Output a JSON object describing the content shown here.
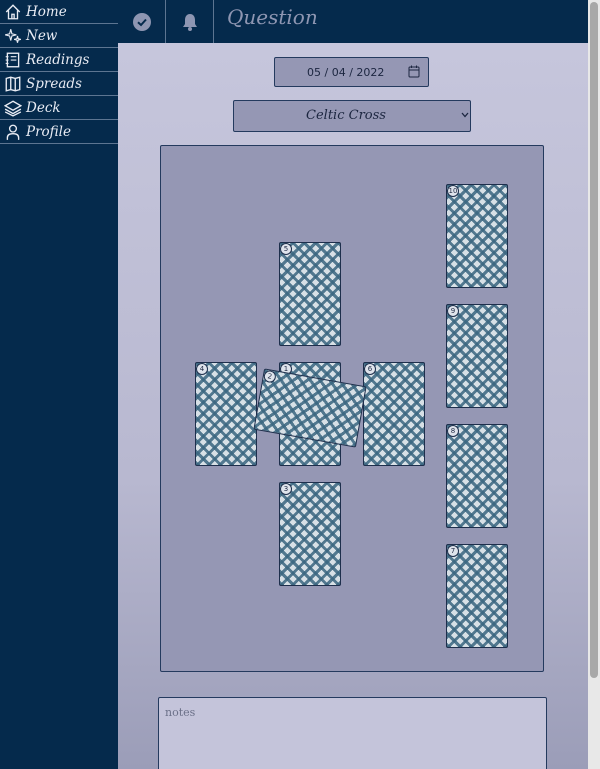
{
  "nav": {
    "items": [
      {
        "label": "Home",
        "icon": "home-icon"
      },
      {
        "label": "New",
        "icon": "sparkle-icon"
      },
      {
        "label": "Readings",
        "icon": "journal-icon"
      },
      {
        "label": "Spreads",
        "icon": "map-icon"
      },
      {
        "label": "Deck",
        "icon": "layers-icon"
      },
      {
        "label": "Profile",
        "icon": "person-icon"
      }
    ]
  },
  "header": {
    "title": "Question",
    "confirm_icon": "check-circle-icon",
    "notification_icon": "bell-icon"
  },
  "form": {
    "date_value": "05 / 04 / 2022",
    "spread_value": "Celtic Cross",
    "notes_placeholder": "notes"
  },
  "cards": [
    {
      "number": "1"
    },
    {
      "number": "2"
    },
    {
      "number": "3"
    },
    {
      "number": "4"
    },
    {
      "number": "5"
    },
    {
      "number": "6"
    },
    {
      "number": "7"
    },
    {
      "number": "8"
    },
    {
      "number": "9"
    },
    {
      "number": "10"
    }
  ],
  "colors": {
    "sidebar_bg": "#052a4c",
    "board_bg": "#9597b4",
    "card_pattern": "#3a6680"
  }
}
